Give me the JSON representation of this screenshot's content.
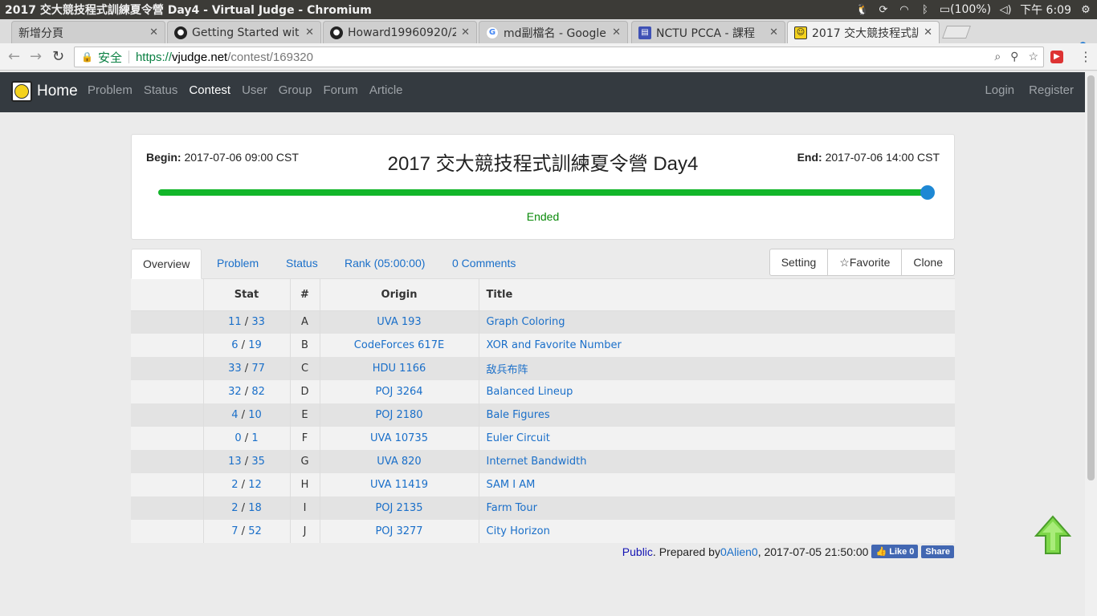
{
  "os": {
    "window_title": "2017 交大競技程式訓練夏令營 Day4 - Virtual Judge - Chromium",
    "battery": "(100%)",
    "clock": "下午 6:09"
  },
  "browser": {
    "tabs": [
      {
        "label": "新增分頁",
        "icon": "blank-page-icon"
      },
      {
        "label": "Getting Started wit",
        "icon": "github-icon"
      },
      {
        "label": "Howard19960920/2",
        "icon": "github-icon"
      },
      {
        "label": "md副檔名 - Google",
        "icon": "google-icon"
      },
      {
        "label": "NCTU PCCA - 課程",
        "icon": "site-icon"
      },
      {
        "label": "2017 交大競技程式訓",
        "icon": "vjudge-icon",
        "active": true
      }
    ],
    "address": {
      "secure_label": "安全",
      "scheme": "https://",
      "host": "vjudge.net",
      "path": "/contest/169320"
    }
  },
  "site": {
    "brand": "Home",
    "nav": [
      "Problem",
      "Status",
      "Contest",
      "User",
      "Group",
      "Forum",
      "Article"
    ],
    "active_nav": "Contest",
    "login": "Login",
    "register": "Register"
  },
  "contest": {
    "begin_label": "Begin:",
    "begin_value": "2017-07-06 09:00 CST",
    "end_label": "End:",
    "end_value": "2017-07-06 14:00 CST",
    "title": "2017 交大競技程式訓練夏令營 Day4",
    "progress": 1.0,
    "status": "Ended"
  },
  "tabs": {
    "overview": "Overview",
    "problem": "Problem",
    "status": "Status",
    "rank": "Rank (05:00:00)",
    "comments": "0 Comments",
    "setting": "Setting",
    "favorite": "☆Favorite",
    "clone": "Clone"
  },
  "table": {
    "headers": {
      "stat": "Stat",
      "num": "#",
      "origin": "Origin",
      "title": "Title"
    },
    "rows": [
      {
        "solved": "11",
        "tried": "33",
        "num": "A",
        "origin": "UVA 193",
        "title": "Graph Coloring"
      },
      {
        "solved": "6",
        "tried": "19",
        "num": "B",
        "origin": "CodeForces 617E",
        "title": "XOR and Favorite Number"
      },
      {
        "solved": "33",
        "tried": "77",
        "num": "C",
        "origin": "HDU 1166",
        "title": "敌兵布阵"
      },
      {
        "solved": "32",
        "tried": "82",
        "num": "D",
        "origin": "POJ 3264",
        "title": "Balanced Lineup"
      },
      {
        "solved": "4",
        "tried": "10",
        "num": "E",
        "origin": "POJ 2180",
        "title": "Bale Figures"
      },
      {
        "solved": "0",
        "tried": "1",
        "num": "F",
        "origin": "UVA 10735",
        "title": "Euler Circuit"
      },
      {
        "solved": "13",
        "tried": "35",
        "num": "G",
        "origin": "UVA 820",
        "title": "Internet Bandwidth"
      },
      {
        "solved": "2",
        "tried": "12",
        "num": "H",
        "origin": "UVA 11419",
        "title": "SAM I AM"
      },
      {
        "solved": "2",
        "tried": "18",
        "num": "I",
        "origin": "POJ 2135",
        "title": "Farm Tour"
      },
      {
        "solved": "7",
        "tried": "52",
        "num": "J",
        "origin": "POJ 3277",
        "title": "City Horizon"
      }
    ]
  },
  "footer": {
    "public": "Public",
    "prepared": ". Prepared by ",
    "author": "0Alien0",
    "time": ", 2017-07-05 21:50:00",
    "like": "Like 0",
    "share": "Share"
  },
  "colors": {
    "navbar": "#343a40",
    "link": "#1a6fc9",
    "progress_fill": "#12b62a",
    "progress_knob": "#1e88d4",
    "status_ended": "#0a8a0a"
  }
}
